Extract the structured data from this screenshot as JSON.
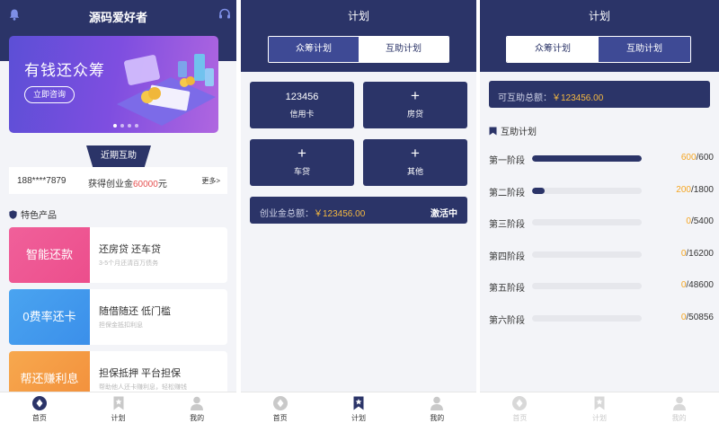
{
  "screen1": {
    "title": "源码爱好者",
    "banner": {
      "title": "有钱还众筹",
      "button": "立即咨询",
      "slides": 4,
      "active_slide": 1
    },
    "recent_tab": "近期互助",
    "recent": {
      "phone": "188****7879",
      "text_prefix": "获得创业金",
      "amount": "60000",
      "text_suffix": "元",
      "more": "更多>"
    },
    "featured_title": "特色产品",
    "products": [
      {
        "thumb": "智能还款",
        "title": "还房贷 还车贷",
        "subtitle": "3-5个月还清百万债务",
        "color_from": "#f0609a",
        "color_to": "#ec4e8c"
      },
      {
        "thumb": "0费率还卡",
        "title": "随借随还 低门槛",
        "subtitle": "担保金抵扣利息",
        "color_from": "#4aa4f0",
        "color_to": "#3b8fea"
      },
      {
        "thumb": "帮还赚利息",
        "title": "担保抵押 平台担保",
        "subtitle": "帮助他人还卡赚利息，轻松赚钱",
        "color_from": "#f7a84e",
        "color_to": "#f28f3b"
      }
    ],
    "tabbar": [
      {
        "label": "首页",
        "icon": "home-icon"
      },
      {
        "label": "计划",
        "icon": "bookmark-icon"
      },
      {
        "label": "我的",
        "icon": "user-icon"
      }
    ]
  },
  "screen2": {
    "title": "计划",
    "segments": [
      "众筹计划",
      "互助计划"
    ],
    "active_segment": 1,
    "tiles": [
      {
        "top": "123456",
        "bottom": "信用卡"
      },
      {
        "top": "+",
        "bottom": "房贷"
      },
      {
        "top": "+",
        "bottom": "车贷"
      },
      {
        "top": "+",
        "bottom": "其他"
      }
    ],
    "total": {
      "label": "创业金总额：",
      "amount": "￥123456.00",
      "status": "激活中"
    },
    "tabbar": [
      {
        "label": "首页",
        "icon": "home-icon"
      },
      {
        "label": "计划",
        "icon": "bookmark-icon"
      },
      {
        "label": "我的",
        "icon": "user-icon"
      }
    ]
  },
  "screen3": {
    "title": "计划",
    "segments": [
      "众筹计划",
      "互助计划"
    ],
    "active_segment": 2,
    "available": {
      "label": "可互助总额：",
      "amount": "￥123456.00"
    },
    "section_title": "互助计划",
    "stages": [
      {
        "name": "第一阶段",
        "done": 600,
        "total": 600
      },
      {
        "name": "第二阶段",
        "done": 200,
        "total": 1800
      },
      {
        "name": "第三阶段",
        "done": 0,
        "total": 5400
      },
      {
        "name": "第四阶段",
        "done": 0,
        "total": 16200
      },
      {
        "name": "第五阶段",
        "done": 0,
        "total": 48600
      },
      {
        "name": "第六阶段",
        "done": 0,
        "total": 50856
      }
    ],
    "tabbar": [
      {
        "label": "首页",
        "icon": "home-icon"
      },
      {
        "label": "计划",
        "icon": "bookmark-icon"
      },
      {
        "label": "我的",
        "icon": "user-icon"
      }
    ]
  },
  "colors": {
    "brand": "#2b3468",
    "accent": "#f5b940",
    "highlight": "#e65050",
    "progress_done": "#f5a623"
  }
}
